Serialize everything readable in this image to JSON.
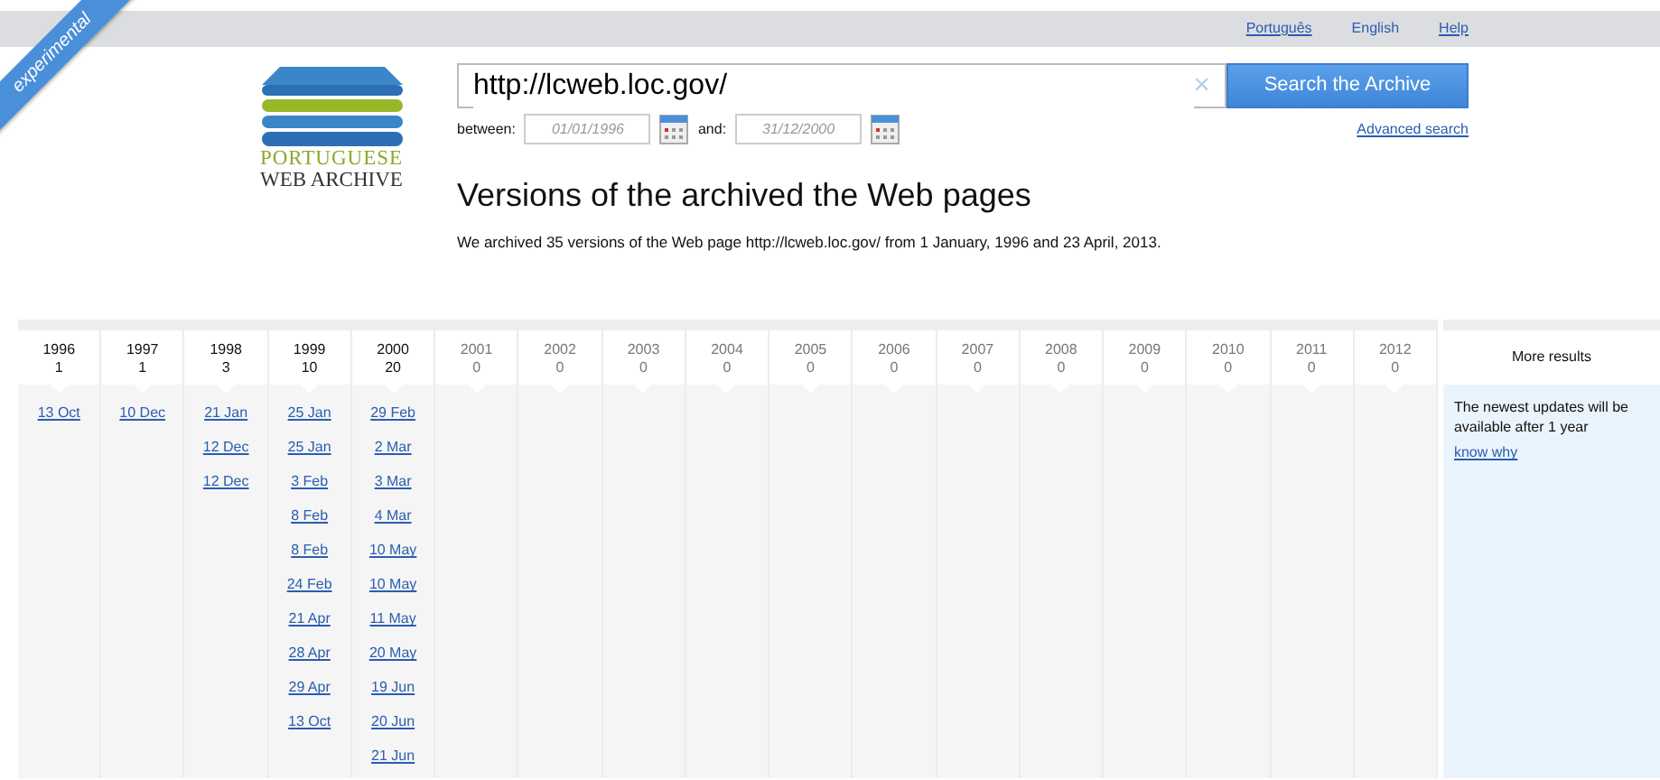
{
  "ribbon": {
    "text": "experimental"
  },
  "top_bar": {
    "languages": [
      {
        "label": "Português",
        "selected": false
      },
      {
        "label": "English",
        "selected": true
      }
    ],
    "help": "Help"
  },
  "logo": {
    "line_1": "PORTUGUESE",
    "line_2": "WEB ARCHIVE"
  },
  "search": {
    "value": "http://lcweb.loc.gov/",
    "clear": "×",
    "button": "Search the Archive",
    "advanced": "Advanced search",
    "between_label": "between:",
    "from_placeholder": "01/01/1996",
    "and_label": "and:",
    "to_placeholder": "31/12/2000"
  },
  "heading": "Versions of the archived the Web pages",
  "summary": "We archived 35 versions of the Web page http://lcweb.loc.gov/ from 1 January, 1996 and 23 April, 2013.",
  "years": [
    {
      "year": "1996",
      "count": "1",
      "disabled": false,
      "dates": [
        "13 Oct"
      ]
    },
    {
      "year": "1997",
      "count": "1",
      "disabled": false,
      "dates": [
        "10 Dec"
      ]
    },
    {
      "year": "1998",
      "count": "3",
      "disabled": false,
      "dates": [
        "21 Jan",
        "12 Dec",
        "12 Dec"
      ]
    },
    {
      "year": "1999",
      "count": "10",
      "disabled": false,
      "dates": [
        "25 Jan",
        "25 Jan",
        "3 Feb",
        "8 Feb",
        "8 Feb",
        "24 Feb",
        "21 Apr",
        "28 Apr",
        "29 Apr",
        "13 Oct"
      ]
    },
    {
      "year": "2000",
      "count": "20",
      "disabled": false,
      "dates": [
        "29 Feb",
        "2 Mar",
        "3 Mar",
        "4 Mar",
        "10 May",
        "10 May",
        "11 May",
        "20 May",
        "19 Jun",
        "20 Jun",
        "21 Jun"
      ]
    },
    {
      "year": "2001",
      "count": "0",
      "disabled": true
    },
    {
      "year": "2002",
      "count": "0",
      "disabled": true
    },
    {
      "year": "2003",
      "count": "0",
      "disabled": true
    },
    {
      "year": "2004",
      "count": "0",
      "disabled": true
    },
    {
      "year": "2005",
      "count": "0",
      "disabled": true
    },
    {
      "year": "2006",
      "count": "0",
      "disabled": true
    },
    {
      "year": "2007",
      "count": "0",
      "disabled": true
    },
    {
      "year": "2008",
      "count": "0",
      "disabled": true
    },
    {
      "year": "2009",
      "count": "0",
      "disabled": true
    },
    {
      "year": "2010",
      "count": "0",
      "disabled": true
    },
    {
      "year": "2011",
      "count": "0",
      "disabled": true
    },
    {
      "year": "2012",
      "count": "0",
      "disabled": true
    }
  ],
  "more_results": {
    "title": "More results",
    "note": "The newest updates will be available after 1 year",
    "link": "know why"
  }
}
